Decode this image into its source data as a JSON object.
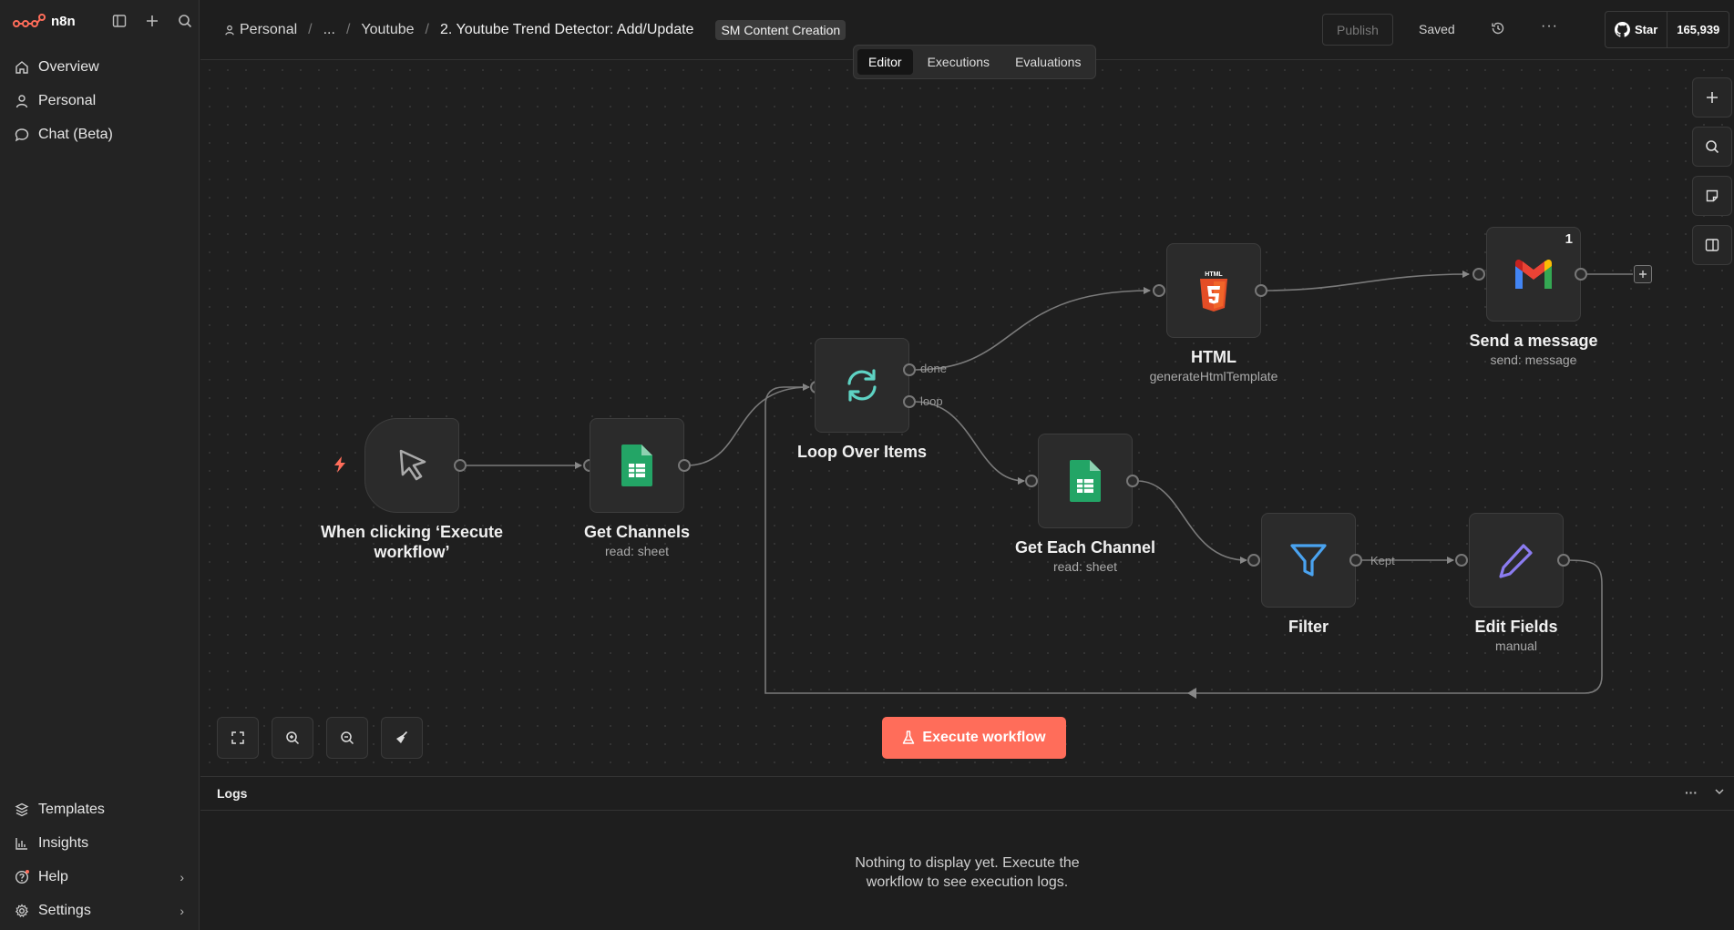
{
  "app": {
    "name": "n8n",
    "brand_color": "#ff6d5a"
  },
  "sidebar": {
    "top_items": [
      {
        "label": "Overview",
        "icon": "home-icon"
      },
      {
        "label": "Personal",
        "icon": "user-icon"
      },
      {
        "label": "Chat (Beta)",
        "icon": "chat-icon"
      }
    ],
    "bottom_items": [
      {
        "label": "Templates",
        "icon": "templates-icon"
      },
      {
        "label": "Insights",
        "icon": "insights-icon"
      },
      {
        "label": "Help",
        "icon": "help-icon"
      },
      {
        "label": "Settings",
        "icon": "settings-icon"
      }
    ]
  },
  "header": {
    "breadcrumb": [
      "Personal",
      "...",
      "Youtube"
    ],
    "title": "2. Youtube Trend Detector: Add/Update",
    "tag": "SM Content Creation",
    "publish_label": "Publish",
    "saved_label": "Saved",
    "github": {
      "star_label": "Star",
      "count": "165,939"
    }
  },
  "tabs": [
    "Editor",
    "Executions",
    "Evaluations"
  ],
  "active_tab": "Editor",
  "nodes": {
    "trigger": {
      "title": "When clicking ‘Execute workflow’",
      "title_line1": "When clicking ‘Execute",
      "title_line2": "workflow’"
    },
    "get_channels": {
      "title": "Get Channels",
      "subtitle": "read: sheet"
    },
    "loop": {
      "title": "Loop Over Items",
      "out_done": "done",
      "out_loop": "loop"
    },
    "html": {
      "title": "HTML",
      "subtitle": "generateHtmlTemplate",
      "icon_text": "HTML"
    },
    "send_message": {
      "title": "Send a message",
      "subtitle": "send: message",
      "badge": "1"
    },
    "get_each_channel": {
      "title": "Get Each Channel",
      "subtitle": "read: sheet"
    },
    "filter": {
      "title": "Filter",
      "out_kept": "Kept"
    },
    "edit_fields": {
      "title": "Edit Fields",
      "subtitle": "manual"
    }
  },
  "canvas": {
    "execute_label": "Execute workflow"
  },
  "logs": {
    "title": "Logs",
    "empty_line1": "Nothing to display yet. Execute the",
    "empty_line2": "workflow to see execution logs."
  }
}
